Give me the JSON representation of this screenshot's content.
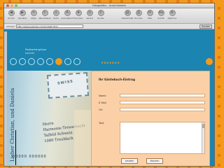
{
  "window": {
    "title": "Fotografien – Ansichtskarte",
    "traffic_colors": [
      "#e0574d",
      "#e9b33c",
      "#7ac453"
    ]
  },
  "toolbar": {
    "buttons": [
      {
        "label": "Zurück",
        "icon": "back-arrow-icon"
      },
      {
        "label": "Vorwärts",
        "icon": "forward-arrow-icon"
      },
      {
        "label": "Stopp",
        "icon": "stop-icon"
      },
      {
        "label": "Aktualisieren",
        "icon": "refresh-icon"
      },
      {
        "label": "Home",
        "icon": "home-icon"
      },
      {
        "label": "Automatisch",
        "icon": "auto-icon"
      },
      {
        "label": "Favoriten",
        "icon": "favorites-icon"
      },
      {
        "label": "Verlauf",
        "icon": "history-icon"
      },
      {
        "label": "Suchen",
        "icon": "search-icon"
      },
      {
        "label": "Seiteninhalt",
        "icon": "page-icon"
      },
      {
        "label": "Drucken",
        "icon": "print-icon"
      },
      {
        "label": "Mail",
        "icon": "mail-icon"
      },
      {
        "label": "Schrift",
        "icon": "font-icon"
      },
      {
        "label": "Optionen",
        "icon": "options-icon"
      }
    ]
  },
  "address": {
    "label": "Adresse",
    "url": "http://www.example.com/kontakt.html",
    "go": "Suchen"
  },
  "page": {
    "brand_line1": "Postkartengrüsse",
    "brand_line2": "kontakt",
    "nav_badge": "ERKERER",
    "dots_active_index": 5,
    "dots_count": 8
  },
  "postcard": {
    "handwriting_1": "Lieber Christian,",
    "handwriting_2": "und Daniela",
    "stamp_text": "SWISS",
    "address_lines": [
      "Herrn",
      "Harmonie Treuschacht",
      "Talfeld Schweiz",
      "1080 Treublach"
    ],
    "barcode": "00000 000000"
  },
  "form": {
    "title": "Ihr Gästebuch-Eintrag",
    "fields": [
      {
        "label": "Name",
        "value": ""
      },
      {
        "label": "E-Mail",
        "value": ""
      },
      {
        "label": "Ort",
        "value": ""
      }
    ],
    "text_label": "Text",
    "text_value": "",
    "submit": "senden",
    "reset": "löschen"
  }
}
